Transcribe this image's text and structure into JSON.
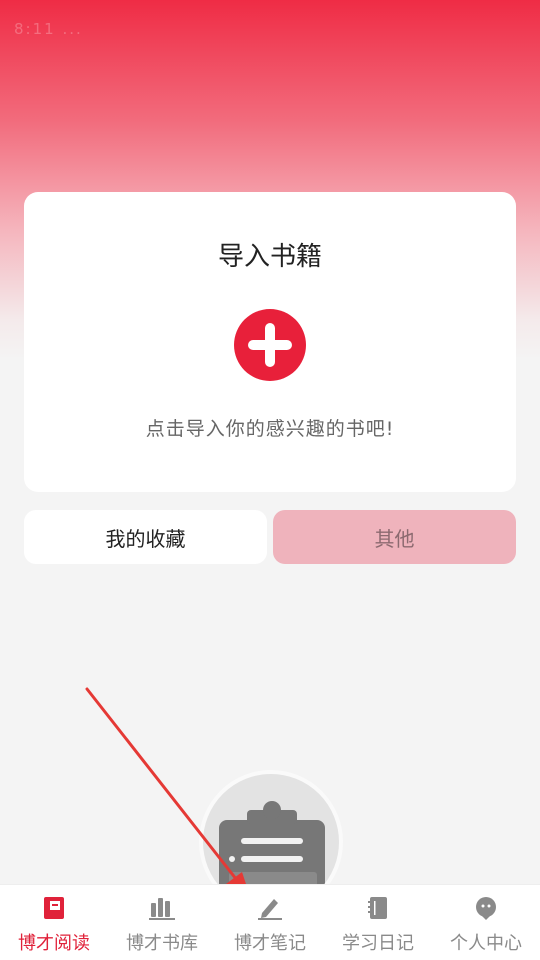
{
  "status_bar": {
    "text": "8:11 ..."
  },
  "import_card": {
    "title": "导入书籍",
    "hint": "点击导入你的感兴趣的书吧!"
  },
  "segments": {
    "favorites": "我的收藏",
    "other": "其他"
  },
  "tabs": [
    {
      "label": "博才阅读",
      "icon": "book-icon",
      "active": true
    },
    {
      "label": "博才书库",
      "icon": "library-icon",
      "active": false
    },
    {
      "label": "博才笔记",
      "icon": "note-edit-icon",
      "active": false
    },
    {
      "label": "学习日记",
      "icon": "diary-icon",
      "active": false
    },
    {
      "label": "个人中心",
      "icon": "profile-icon",
      "active": false
    }
  ],
  "colors": {
    "brand_red": "#e8203a",
    "active_tab": "#e0223a",
    "inactive_tab": "#8a8a8a",
    "annotation_arrow": "#e53935"
  }
}
